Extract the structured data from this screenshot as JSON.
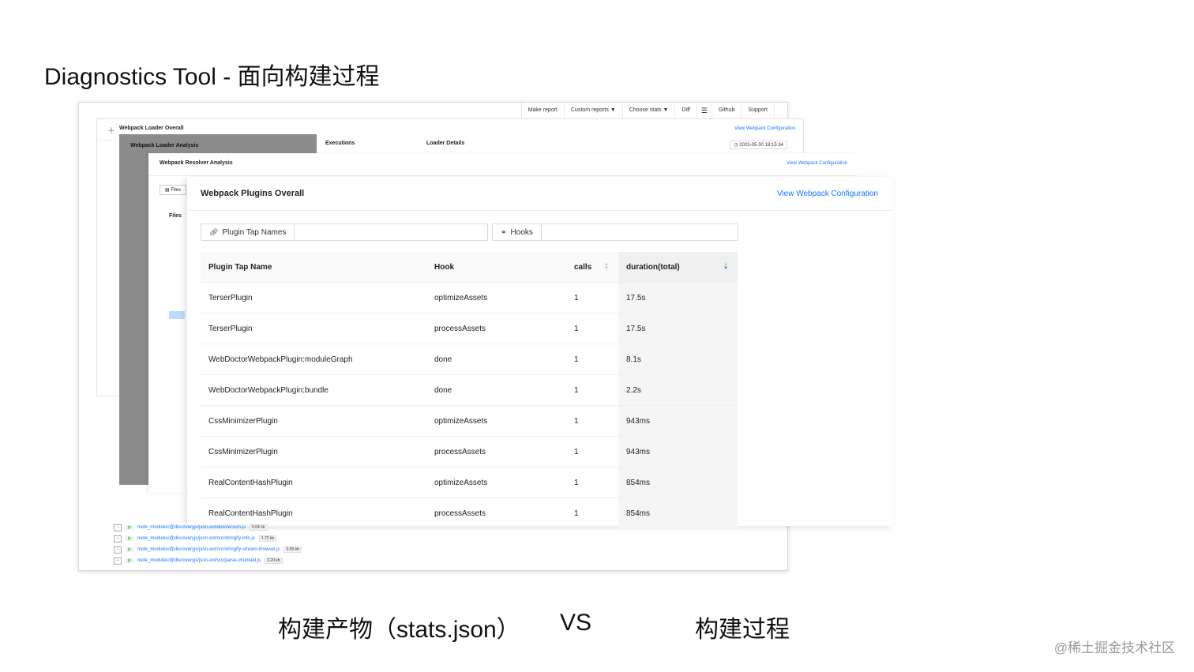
{
  "slide": {
    "title": "Diagnostics Tool - 面向构建过程",
    "caption_left": "构建产物（stats.json）",
    "caption_vs": "VS",
    "caption_right": "构建过程",
    "watermark": "@稀土掘金技术社区"
  },
  "topnav": {
    "make_report": "Make report",
    "custom_reports": "Custom reports ▼",
    "choose_stats": "Choose stats ▼",
    "diff": "Diff",
    "menu_icon": "☰",
    "github": "Github",
    "support": "Support"
  },
  "loader_overall": {
    "title": "Webpack Loader Overall",
    "link": "View Webpack Configuration"
  },
  "loader_analysis": {
    "title": "Webpack Loader Analysis",
    "executions": "Executions",
    "loader_details": "Loader Details",
    "timestamp": "2023-05-30 18:15:34"
  },
  "resolver": {
    "title": "Webpack Resolver Analysis",
    "link": "View Webpack Configuration",
    "files": "Files",
    "files_btn": "Files"
  },
  "plugins": {
    "title": "Webpack Plugins Overall",
    "link": "View Webpack Configuration",
    "filter_tap_label": "Plugin Tap Names",
    "filter_hooks_label": "Hooks",
    "columns": [
      "Plugin Tap Name",
      "Hook",
      "calls",
      "duration(total)"
    ],
    "rows": [
      [
        "TerserPlugin",
        "optimizeAssets",
        "1",
        "17.5s"
      ],
      [
        "TerserPlugin",
        "processAssets",
        "1",
        "17.5s"
      ],
      [
        "WebDoctorWebpackPlugin:moduleGraph",
        "done",
        "1",
        "8.1s"
      ],
      [
        "WebDoctorWebpackPlugin:bundle",
        "done",
        "1",
        "2.2s"
      ],
      [
        "CssMinimizerPlugin",
        "optimizeAssets",
        "1",
        "943ms"
      ],
      [
        "CssMinimizerPlugin",
        "processAssets",
        "1",
        "943ms"
      ],
      [
        "RealContentHashPlugin",
        "optimizeAssets",
        "1",
        "854ms"
      ],
      [
        "RealContentHashPlugin",
        "processAssets",
        "1",
        "854ms"
      ]
    ]
  },
  "files": [
    {
      "ext": "js",
      "path": "node_modules/@discoveryjs/json-ext/dist/version.js",
      "size": "0.04 kb"
    },
    {
      "ext": "js",
      "path": "node_modules/@discoveryjs/json-ext/src/stringify-info.js",
      "size": "1.72 kb"
    },
    {
      "ext": "js",
      "path": "node_modules/@discoveryjs/json-ext/src/stringify-stream-browser.js",
      "size": "0.09 kb"
    },
    {
      "ext": "js",
      "path": "node_modules/@discoveryjs/json-ext/src/parse-chunked.js",
      "size": "3.20 kb"
    }
  ]
}
